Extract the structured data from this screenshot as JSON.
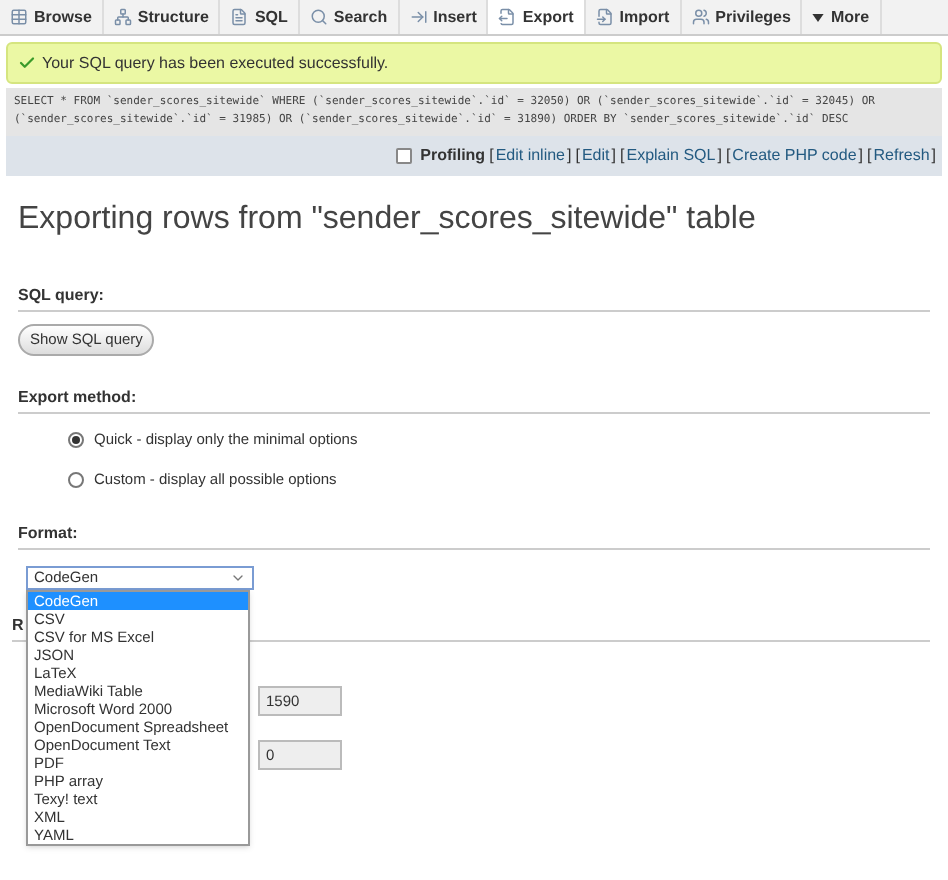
{
  "tabs": [
    {
      "label": "Browse",
      "selected": false
    },
    {
      "label": "Structure",
      "selected": false
    },
    {
      "label": "SQL",
      "selected": false
    },
    {
      "label": "Search",
      "selected": false
    },
    {
      "label": "Insert",
      "selected": false
    },
    {
      "label": "Export",
      "selected": true
    },
    {
      "label": "Import",
      "selected": false
    },
    {
      "label": "Privileges",
      "selected": false
    },
    {
      "label": "More",
      "selected": false
    }
  ],
  "success_message": "Your SQL query has been executed successfully.",
  "sql": "SELECT * FROM `sender_scores_sitewide` WHERE (`sender_scores_sitewide`.`id` = 32050) OR (`sender_scores_sitewide`.`id` = 32045) OR (`sender_scores_sitewide`.`id` = 31985) OR (`sender_scores_sitewide`.`id` = 31890) ORDER BY `sender_scores_sitewide`.`id` DESC",
  "profiling": {
    "label": "Profiling",
    "checked": false
  },
  "sql_links": [
    {
      "open": "[",
      "label": "Edit inline",
      "close": "]"
    },
    {
      "open": "[",
      "label": "Edit",
      "close": "]"
    },
    {
      "open": "[",
      "label": "Explain SQL",
      "close": "]"
    },
    {
      "open": "[",
      "label": "Create PHP code",
      "close": "]"
    },
    {
      "open": "[",
      "label": "Refresh",
      "close": "]"
    }
  ],
  "title": "Exporting rows from \"sender_scores_sitewide\" table",
  "sql_query_section": {
    "heading": "SQL query:",
    "button": "Show SQL query"
  },
  "export_method": {
    "heading": "Export method:",
    "options": [
      {
        "label": "Quick - display only the minimal options",
        "selected": true
      },
      {
        "label": "Custom - display all possible options",
        "selected": false
      }
    ]
  },
  "format": {
    "heading": "Format:",
    "value": "CodeGen",
    "expanded": true,
    "options": [
      {
        "label": "CodeGen",
        "selected": true
      },
      {
        "label": "CSV",
        "selected": false
      },
      {
        "label": "CSV for MS Excel",
        "selected": false
      },
      {
        "label": "JSON",
        "selected": false
      },
      {
        "label": "LaTeX",
        "selected": false
      },
      {
        "label": "MediaWiki Table",
        "selected": false
      },
      {
        "label": "Microsoft Word 2000",
        "selected": false
      },
      {
        "label": "OpenDocument Spreadsheet",
        "selected": false
      },
      {
        "label": "OpenDocument Text",
        "selected": false
      },
      {
        "label": "PDF",
        "selected": false
      },
      {
        "label": "PHP array",
        "selected": false
      },
      {
        "label": "Texy! text",
        "selected": false
      },
      {
        "label": "XML",
        "selected": false
      },
      {
        "label": "YAML",
        "selected": false
      }
    ]
  },
  "rows_section": {
    "heading": "R",
    "fields": [
      {
        "value": "1590"
      },
      {
        "value": "0"
      }
    ]
  }
}
